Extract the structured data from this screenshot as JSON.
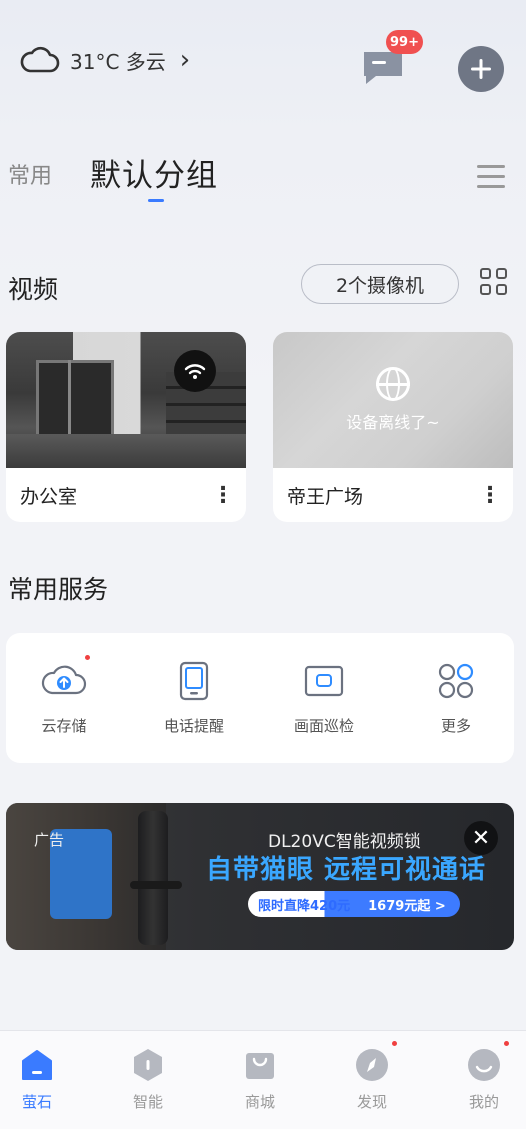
{
  "header": {
    "weather_text": "31°C 多云",
    "weather_chevron": "›",
    "message_badge": "99+",
    "add_icon": "plus-icon"
  },
  "tabs": {
    "common": "常用",
    "default_group": "默认分组"
  },
  "video": {
    "title": "视频",
    "camera_count": "2个摄像机",
    "cameras": [
      {
        "name": "办公室",
        "menu": "⋮",
        "status": "online"
      },
      {
        "name": "帝王广场",
        "menu": "⋮",
        "status": "offline",
        "offline_text": "设备离线了~"
      }
    ]
  },
  "services": {
    "title": "常用服务",
    "items": [
      {
        "label": "云存储",
        "icon": "cloud-upload-icon"
      },
      {
        "label": "电话提醒",
        "icon": "phone-icon"
      },
      {
        "label": "画面巡检",
        "icon": "screen-icon"
      },
      {
        "label": "更多",
        "icon": "more-grid-icon"
      }
    ]
  },
  "ad": {
    "tag": "广告",
    "model": "DL20VC智能视频锁",
    "headline": "自带猫眼  远程可视通话",
    "pill_left": "限时直降420元",
    "pill_right": "1679元起 >"
  },
  "bottom_nav": [
    {
      "label": "萤石",
      "active": true
    },
    {
      "label": "智能",
      "active": false
    },
    {
      "label": "商城",
      "active": false
    },
    {
      "label": "发现",
      "active": false
    },
    {
      "label": "我的",
      "active": false
    }
  ],
  "colors": {
    "accent": "#3a7bff",
    "badge": "#f05050",
    "headline": "#3aa7ff"
  }
}
